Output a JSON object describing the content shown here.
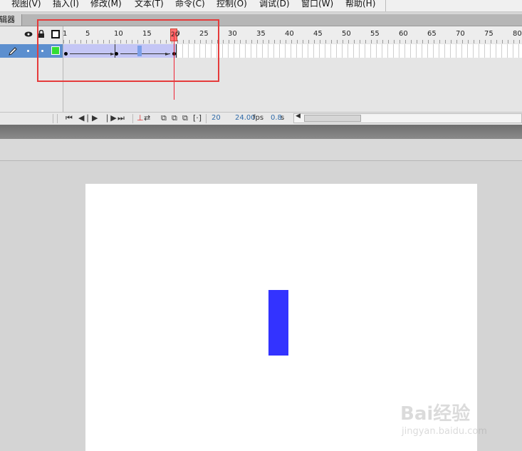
{
  "menu": [
    "视图(V)",
    "插入(I)",
    "修改(M)",
    "文本(T)",
    "命令(C)",
    "控制(O)",
    "调试(D)",
    "窗口(W)",
    "帮助(H)"
  ],
  "panel": {
    "title": "编辑器"
  },
  "timeline": {
    "frame_numbers": [
      "1",
      "5",
      "10",
      "15",
      "20",
      "25",
      "30",
      "35",
      "40",
      "45",
      "50",
      "55",
      "60",
      "65",
      "70",
      "75",
      "80"
    ],
    "current_frame_marker": "20",
    "controls": {
      "frame": "20",
      "fps": "24.00",
      "fps_unit": "fps",
      "time": "0.8",
      "time_unit": "s"
    }
  },
  "stage": {
    "object_color": "#3333ff",
    "highlight_color": "#e53b3b"
  },
  "watermark": {
    "logo": "Bai经验",
    "url": "jingyan.baidu.com"
  }
}
